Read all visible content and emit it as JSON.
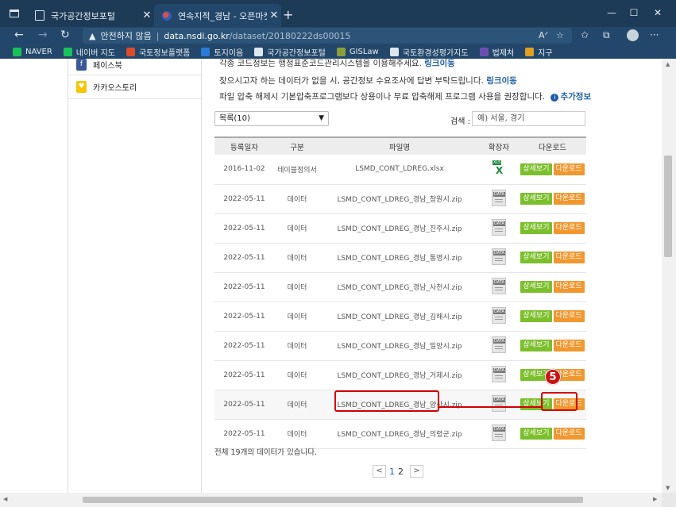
{
  "tabs": [
    {
      "title": "국가공간정보포털",
      "close": "✕"
    },
    {
      "title": "연속지적_경남 - 오픈마켓",
      "close": "✕"
    }
  ],
  "address": {
    "security": "안전하지 않음",
    "domain": "data.nsdi.go.kr",
    "path": "/dataset/20180222ds00015"
  },
  "bookmarks": [
    {
      "label": "NAVER",
      "color": "#19c15b"
    },
    {
      "label": "네이버 지도",
      "color": "#19c15b"
    },
    {
      "label": "국토정보플랫폼",
      "color": "#d94b2b"
    },
    {
      "label": "토지이음",
      "color": "#2b7bd9"
    },
    {
      "label": "국가공간정보포털",
      "color": "#dfe7ee"
    },
    {
      "label": "GISLaw",
      "color": "#8a9f3a"
    },
    {
      "label": "국토환경성평가지도",
      "color": "#dfe7ee"
    },
    {
      "label": "법제처",
      "color": "#6b4fb0"
    },
    {
      "label": "지구",
      "color": "#e0a020"
    }
  ],
  "sidebar": {
    "items": [
      {
        "label": "페이스북",
        "color": "#3b5998",
        "glyph": "f"
      },
      {
        "label": "카카오스토리",
        "color": "#f7c600",
        "glyph": "♥"
      }
    ]
  },
  "notes": {
    "line1_text": "각종 코드정보는 행정표준코드관리시스템을 이용해주세요.",
    "line1_link": "링크이동",
    "line2_text": "찾으시고자 하는 데이터가 없을 시, 공간정보 수요조사에 답변 부탁드립니다.",
    "line2_link": "링크이동",
    "line3_text": "파일 압축 해제시 기본압축프로그램보다 상용이나 무료 압축해제 프로그램 사용을 권장합니다.",
    "line3_link": "추가정보"
  },
  "controls": {
    "page_size": "목록(10)",
    "search_label": "검색 :",
    "search_placeholder": "예) 서울, 경기"
  },
  "table": {
    "headers": [
      "등록일자",
      "구분",
      "파일명",
      "확장자",
      "다운로드"
    ],
    "detail_label": "상세보기",
    "download_label": "다운로드",
    "rows": [
      {
        "date": "2016-11-02",
        "type": "테이블정의서",
        "file": "LSMD_CONT_LDREG.xlsx",
        "ext": "xls"
      },
      {
        "date": "2022-05-11",
        "type": "데이터",
        "file": "LSMD_CONT_LDREG_경남_창원시.zip",
        "ext": "data"
      },
      {
        "date": "2022-05-11",
        "type": "데이터",
        "file": "LSMD_CONT_LDREG_경남_진주시.zip",
        "ext": "data"
      },
      {
        "date": "2022-05-11",
        "type": "데이터",
        "file": "LSMD_CONT_LDREG_경남_통영시.zip",
        "ext": "data"
      },
      {
        "date": "2022-05-11",
        "type": "데이터",
        "file": "LSMD_CONT_LDREG_경남_사천시.zip",
        "ext": "data"
      },
      {
        "date": "2022-05-11",
        "type": "데이터",
        "file": "LSMD_CONT_LDREG_경남_김해시.zip",
        "ext": "data"
      },
      {
        "date": "2022-05-11",
        "type": "데이터",
        "file": "LSMD_CONT_LDREG_경남_밀양시.zip",
        "ext": "data"
      },
      {
        "date": "2022-05-11",
        "type": "데이터",
        "file": "LSMD_CONT_LDREG_경남_거제시.zip",
        "ext": "data"
      },
      {
        "date": "2022-05-11",
        "type": "데이터",
        "file": "LSMD_CONT_LDREG_경남_양산시.zip",
        "ext": "data",
        "highlight": true
      },
      {
        "date": "2022-05-11",
        "type": "데이터",
        "file": "LSMD_CONT_LDREG_경남_의령군.zip",
        "ext": "data"
      }
    ]
  },
  "summary": {
    "total_text": "전체 19개의 데이터가 있습니다."
  },
  "pagination": {
    "prev": "<",
    "pages": [
      "1",
      "2"
    ],
    "next": ">"
  },
  "annotation": {
    "step": "5",
    "color": "#d10000"
  }
}
